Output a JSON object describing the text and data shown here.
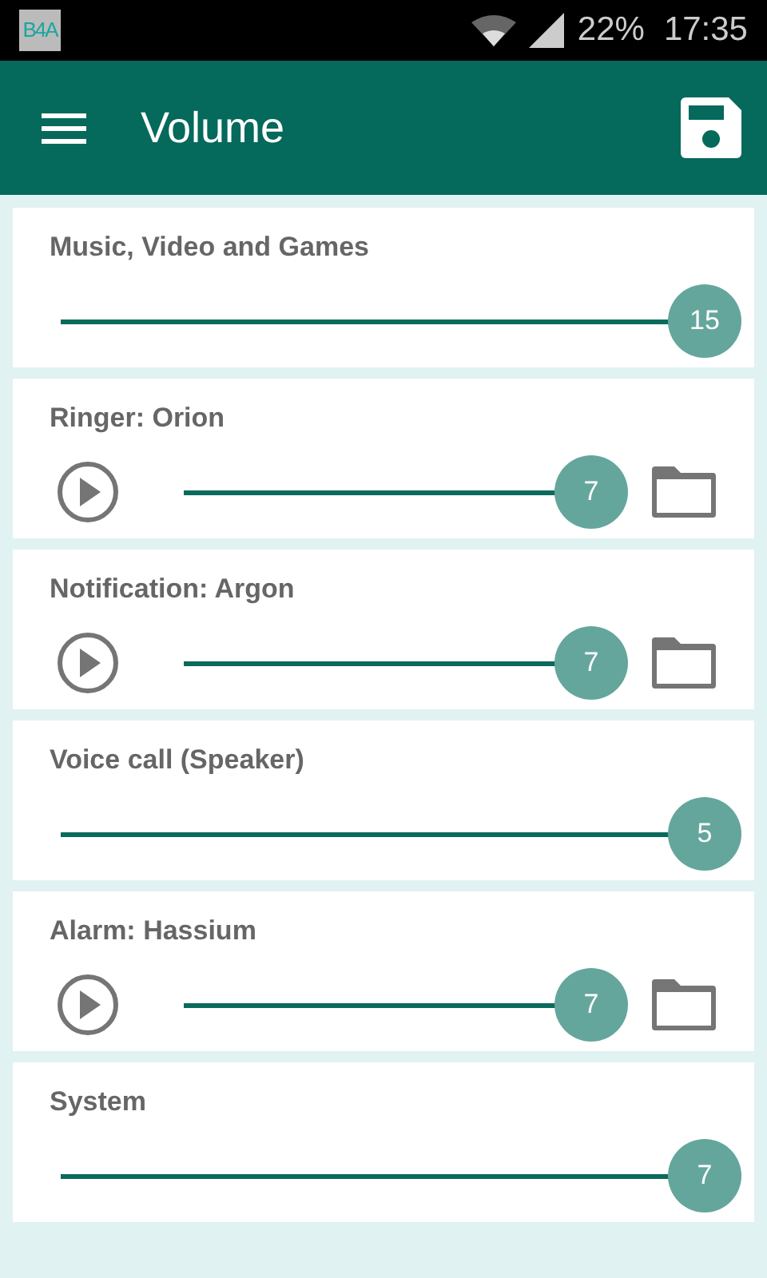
{
  "status_bar": {
    "notification": "B4A",
    "battery": "22%",
    "time": "17:35"
  },
  "app_bar": {
    "title": "Volume"
  },
  "channels": [
    {
      "name": "Music, Video and Games",
      "kind": "plain",
      "level": 1,
      "reading": "15"
    },
    {
      "name": "Ringer: Orion",
      "kind": "tone",
      "level": 1,
      "reading": "7"
    },
    {
      "name": "Notification: Argon",
      "kind": "tone",
      "level": 1,
      "reading": "7"
    },
    {
      "name": "Voice call (Speaker)",
      "kind": "plain",
      "level": 1,
      "reading": "5"
    },
    {
      "name": "Alarm: Hassium",
      "kind": "tone",
      "level": 1,
      "reading": "7"
    },
    {
      "name": "System",
      "kind": "plain",
      "level": 1,
      "reading": "7"
    }
  ]
}
